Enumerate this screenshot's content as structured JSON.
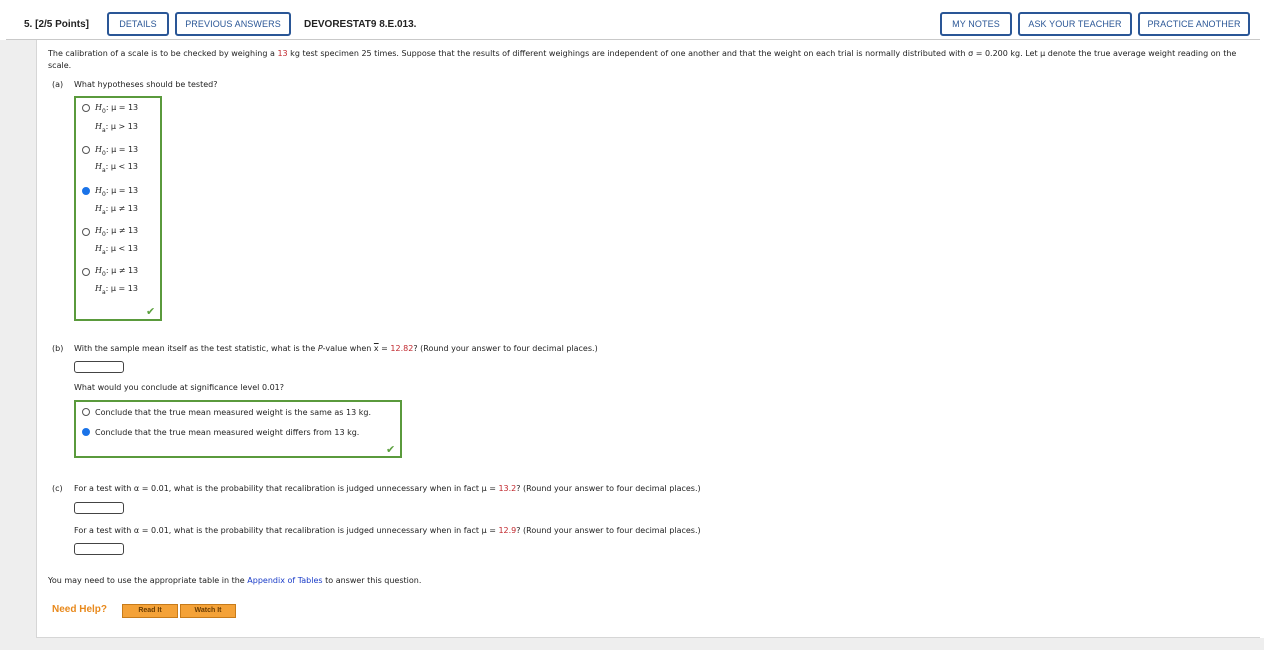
{
  "header": {
    "question_title": "5. [2/5 Points]",
    "details_label": "DETAILS",
    "previous_answers_label": "PREVIOUS ANSWERS",
    "assignment_code": "DEVORESTAT9 8.E.013.",
    "my_notes_label": "MY NOTES",
    "ask_teacher_label": "ASK YOUR TEACHER",
    "practice_another_label": "PRACTICE ANOTHER"
  },
  "problem": {
    "text_1": "The calibration of a scale is to be checked by weighing a ",
    "weight": "13",
    "text_2": " kg test specimen 25 times. Suppose that the results of different weighings are independent of one another and that the weight on each trial is normally distributed with σ = 0.200 kg. Let μ denote the true average weight reading on the scale."
  },
  "part_a": {
    "label": "(a)",
    "question": "What hypotheses should be tested?",
    "options": [
      {
        "h0": "μ = 13",
        "ha": "μ > 13",
        "selected": false
      },
      {
        "h0": "μ = 13",
        "ha": "μ < 13",
        "selected": false
      },
      {
        "h0": "μ = 13",
        "ha": "μ ≠ 13",
        "selected": true
      },
      {
        "h0": "μ ≠ 13",
        "ha": "μ < 13",
        "selected": false
      },
      {
        "h0": "μ ≠ 13",
        "ha": "μ = 13",
        "selected": false
      }
    ]
  },
  "part_b": {
    "label": "(b)",
    "question_1": "With the sample mean itself as the test statistic, what is the ",
    "pvalue_word": "P",
    "question_2": "-value when ",
    "xbar": "x",
    "question_3": " = ",
    "xbar_value": "12.82",
    "question_4": "? (Round your answer to four decimal places.)",
    "answer_value": "",
    "conclude_question": "What would you conclude at significance level 0.01?",
    "options": [
      {
        "text": "Conclude that the true mean measured weight is the same as 13 kg.",
        "selected": false
      },
      {
        "text": "Conclude that the true mean measured weight differs from 13 kg.",
        "selected": true
      }
    ]
  },
  "part_c": {
    "label": "(c)",
    "q1_1": "For a test with α = 0.01, what is the probability that recalibration is judged unnecessary when in fact μ = ",
    "q1_value": "13.2",
    "q1_2": "? (Round your answer to four decimal places.)",
    "q2_1": "For a test with α = 0.01, what is the probability that recalibration is judged unnecessary when in fact μ = ",
    "q2_value": "12.9",
    "q2_2": "? (Round your answer to four decimal places.)"
  },
  "footer": {
    "note_1": "You may need to use the appropriate table in the ",
    "note_link": "Appendix of Tables",
    "note_2": " to answer this question.",
    "need_help": "Need Help?",
    "read_it": "Read It",
    "watch_it": "Watch It"
  },
  "colors": {
    "accent": "#2a5696",
    "highlight_red": "#c1272d",
    "correct_green": "#5a9a3c",
    "selected_blue": "#1a73e8",
    "help_orange": "#f4a238"
  }
}
